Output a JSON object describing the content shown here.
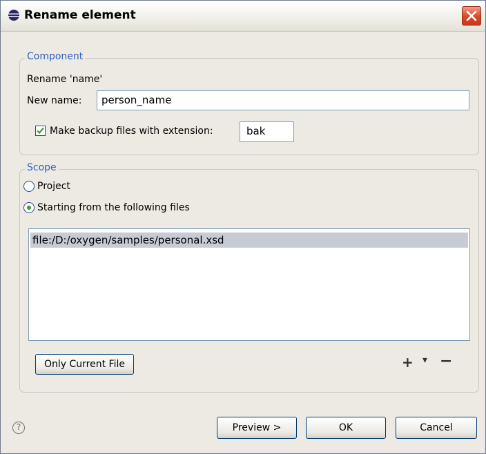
{
  "window": {
    "title": "Rename element"
  },
  "component": {
    "legend": "Component",
    "rename_text": "Rename 'name'",
    "new_name_label": "New name:",
    "new_name_value": "person_name",
    "backup_label": "Make backup files with extension:",
    "backup_checked": true,
    "backup_extension": "bak"
  },
  "scope": {
    "legend": "Scope",
    "option_project": "Project",
    "option_files": "Starting from the following files",
    "selected": "files",
    "files": [
      "file:/D:/oxygen/samples/personal.xsd"
    ],
    "only_current_label": "Only Current File",
    "add_glyph": "+",
    "dropdown_glyph": "▾",
    "remove_glyph": "−"
  },
  "footer": {
    "help_glyph": "?",
    "preview_label": "Preview >",
    "ok_label": "OK",
    "cancel_label": "Cancel"
  },
  "colors": {
    "legend": "#2f5ec4",
    "selection": "#c7cbd6",
    "check": "#3d9a39"
  }
}
